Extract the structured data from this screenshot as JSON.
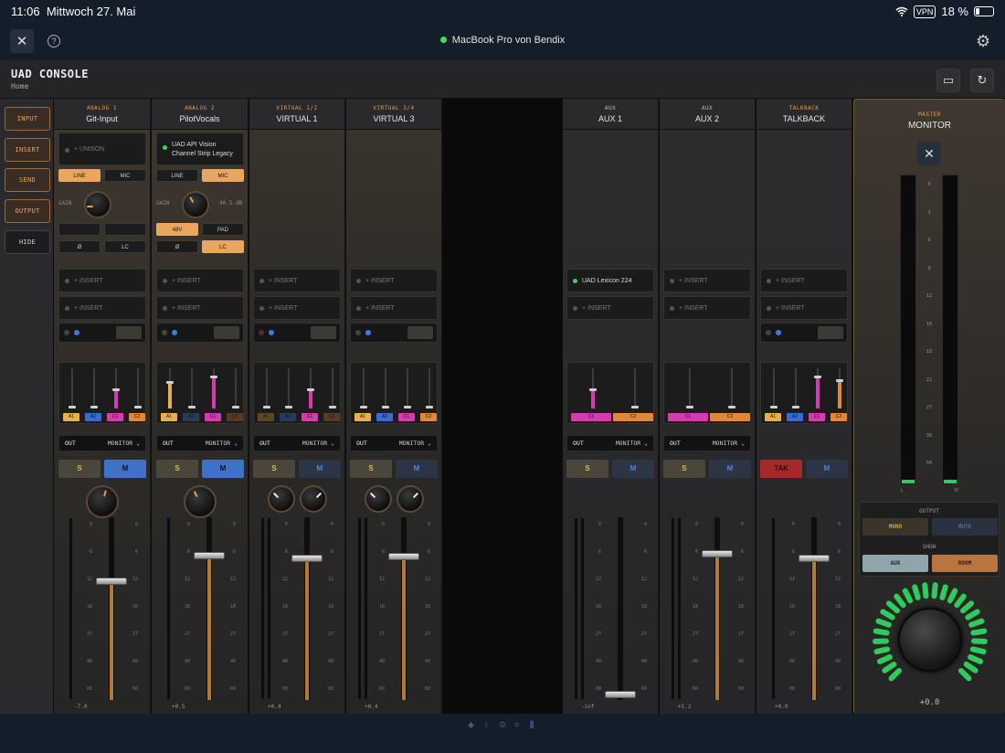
{
  "status": {
    "time": "11:06",
    "date": "Mittwoch 27. Mai",
    "vpn": "VPN",
    "battery": "18 %"
  },
  "toolbar": {
    "device": "MacBook Pro von Bendix"
  },
  "header": {
    "title": "UAD CONSOLE",
    "subtitle": "Home"
  },
  "nav": {
    "input": "INPUT",
    "insert": "INSERT",
    "send": "SEND",
    "output": "OUTPUT",
    "hide": "HIDE"
  },
  "common": {
    "insert_placeholder": "+ INSERT",
    "out": "OUT",
    "monitor": "MONITOR ⌄",
    "solo": "S",
    "mute": "M",
    "talk": "TAK",
    "gain": "GAIN"
  },
  "ch1": {
    "type": "ANALOG 1",
    "name": "Git-Input",
    "unison": "+ UNISON",
    "line": "LINE",
    "mic": "MIC",
    "phase": "Ø",
    "lc": "LC",
    "fader_value": "-7.0"
  },
  "ch2": {
    "type": "ANALOG 2",
    "name": "PilotVocals",
    "plugin_line1": "UAD API Vision",
    "plugin_line2": "Channel Strip Legacy",
    "line": "LINE",
    "mic": "MIC",
    "gain_value": "40.5 dB",
    "v48": "48V",
    "pad": "PAD",
    "phase": "Ø",
    "lc": "LC",
    "fader_value": "+0.5"
  },
  "ch3": {
    "type": "VIRTUAL 1/2",
    "name": "VIRTUAL 1",
    "fader_value": "+0.4"
  },
  "ch4": {
    "type": "VIRTUAL 3/4",
    "name": "VIRTUAL 3",
    "fader_value": "+0.4"
  },
  "aux1": {
    "type": "AUX",
    "name": "AUX 1",
    "plugin": "UAD Lexicon 224",
    "fader_value": "-inf"
  },
  "aux2": {
    "type": "AUX",
    "name": "AUX 2",
    "fader_value": "+1.2"
  },
  "tb": {
    "type": "TALKBACK",
    "name": "TALKBACK",
    "fader_value": "+0.0"
  },
  "send_tags": {
    "a1": "A1",
    "a2": "A2",
    "c1": "C1",
    "c2": "C2"
  },
  "master": {
    "type": "MASTER",
    "name": "MONITOR",
    "output": "OUTPUT",
    "mono": "MONO",
    "mute": "MUTE",
    "show": "SHOW",
    "aux": "AUX",
    "room": "ROOM",
    "value": "+0.0",
    "left": "L",
    "right": "R"
  },
  "meter_scale": [
    "0",
    "3",
    "6",
    "9",
    "12",
    "16",
    "18",
    "21",
    "27",
    "36",
    "50"
  ],
  "fader_scale": [
    "0",
    "6",
    "12",
    "18",
    "27",
    "40",
    "60"
  ],
  "colors": {
    "accent_orange": "#eaa55f",
    "send_pink": "#d63ab0",
    "send_blue": "#3a6cd0",
    "send_orange": "#e0883a",
    "send_yellow": "#e7b04c",
    "meter_green": "#2ecc5a"
  },
  "icons": {
    "logo": "tools-icon",
    "help": "help-icon",
    "settings": "gear-icon",
    "folder": "folder-icon",
    "refresh": "refresh-icon",
    "wifi": "wifi-icon"
  }
}
